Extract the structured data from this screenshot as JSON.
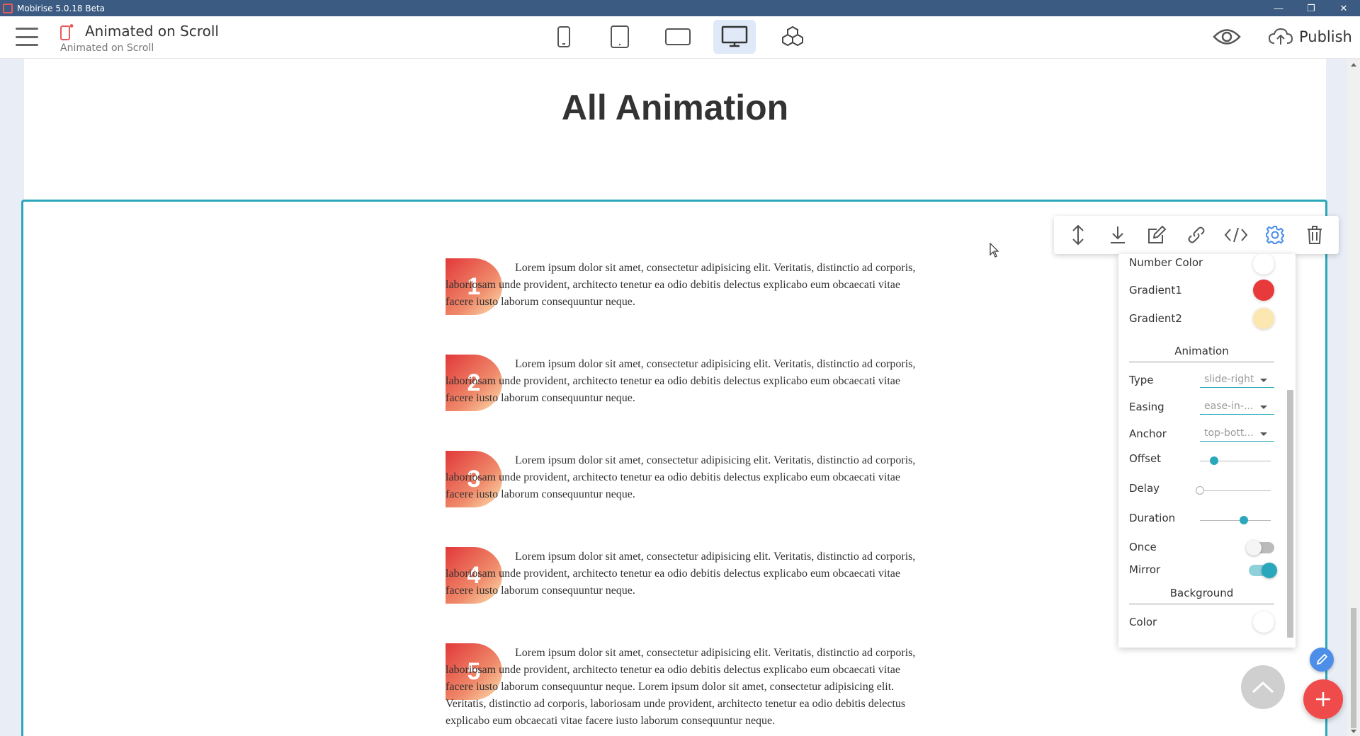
{
  "window": {
    "title": "Mobirise 5.0.18 Beta",
    "controls": [
      "minimize",
      "restore",
      "close"
    ]
  },
  "toolbar": {
    "page_name": "Animated on Scroll",
    "page_subtitle": "Animated on Scroll",
    "devices": [
      {
        "name": "mobile-portrait",
        "active": false
      },
      {
        "name": "tablet-portrait",
        "active": false
      },
      {
        "name": "tablet-landscape",
        "active": false
      },
      {
        "name": "desktop",
        "active": true
      },
      {
        "name": "extensions",
        "active": false
      }
    ],
    "publish_label": "Publish"
  },
  "page": {
    "heading": "All Animation",
    "items": [
      {
        "number": "1",
        "text": "Lorem ipsum dolor sit amet, consectetur adipisicing elit. Veritatis, distinctio ad corporis, laboriosam unde provident, architecto tenetur ea odio debitis delectus explicabo eum obcaecati vitae facere iusto laborum consequuntur neque."
      },
      {
        "number": "2",
        "text": "Lorem ipsum dolor sit amet, consectetur adipisicing elit. Veritatis, distinctio ad corporis, laboriosam unde provident, architecto tenetur ea odio debitis delectus explicabo eum obcaecati vitae facere iusto laborum consequuntur neque."
      },
      {
        "number": "3",
        "text": "Lorem ipsum dolor sit amet, consectetur adipisicing elit. Veritatis, distinctio ad corporis, laboriosam unde provident, architecto tenetur ea odio debitis delectus explicabo eum obcaecati vitae facere iusto laborum consequuntur neque."
      },
      {
        "number": "4",
        "text": "Lorem ipsum dolor sit amet, consectetur adipisicing elit. Veritatis, distinctio ad corporis, laboriosam unde provident, architecto tenetur ea odio debitis delectus explicabo eum obcaecati vitae facere iusto laborum consequuntur neque."
      },
      {
        "number": "5",
        "text": "Lorem ipsum dolor sit amet, consectetur adipisicing elit. Veritatis, distinctio ad corporis, laboriosam unde provident, architecto tenetur ea odio debitis delectus explicabo eum obcaecati vitae facere iusto laborum consequuntur neque. Lorem ipsum dolor sit amet, consectetur adipisicing elit. Veritatis, distinctio ad corporis, laboriosam unde provident, architecto tenetur ea odio debitis delectus explicabo eum obcaecati vitae facere iusto laborum consequuntur neque."
      }
    ]
  },
  "block_tools": [
    "move-icon",
    "download-icon",
    "edit-icon",
    "link-icon",
    "code-icon",
    "gear-icon",
    "trash-icon"
  ],
  "settings": {
    "number_color_label": "Number Color",
    "number_color": "#ffffff",
    "gradient1_label": "Gradient1",
    "gradient1": "#e8393b",
    "gradient2_label": "Gradient2",
    "gradient2": "#fde7b0",
    "animation_section": "Animation",
    "type_label": "Type",
    "type_value": "slide-right",
    "easing_label": "Easing",
    "easing_value": "ease-in-...",
    "anchor_label": "Anchor",
    "anchor_value": "top-bott...",
    "offset_label": "Offset",
    "offset_level": 0.2,
    "delay_label": "Delay",
    "delay_level": 0,
    "duration_label": "Duration",
    "duration_level": 0.62,
    "once_label": "Once",
    "once_on": false,
    "mirror_label": "Mirror",
    "mirror_on": true,
    "background_section": "Background",
    "color_label": "Color",
    "color_value": "#ffffff"
  },
  "colors": {
    "accent": "#2aa7bb",
    "titlebar": "#3b5b82",
    "fab_add": "#f04b4b",
    "fab_edit": "#4c8ee8"
  }
}
